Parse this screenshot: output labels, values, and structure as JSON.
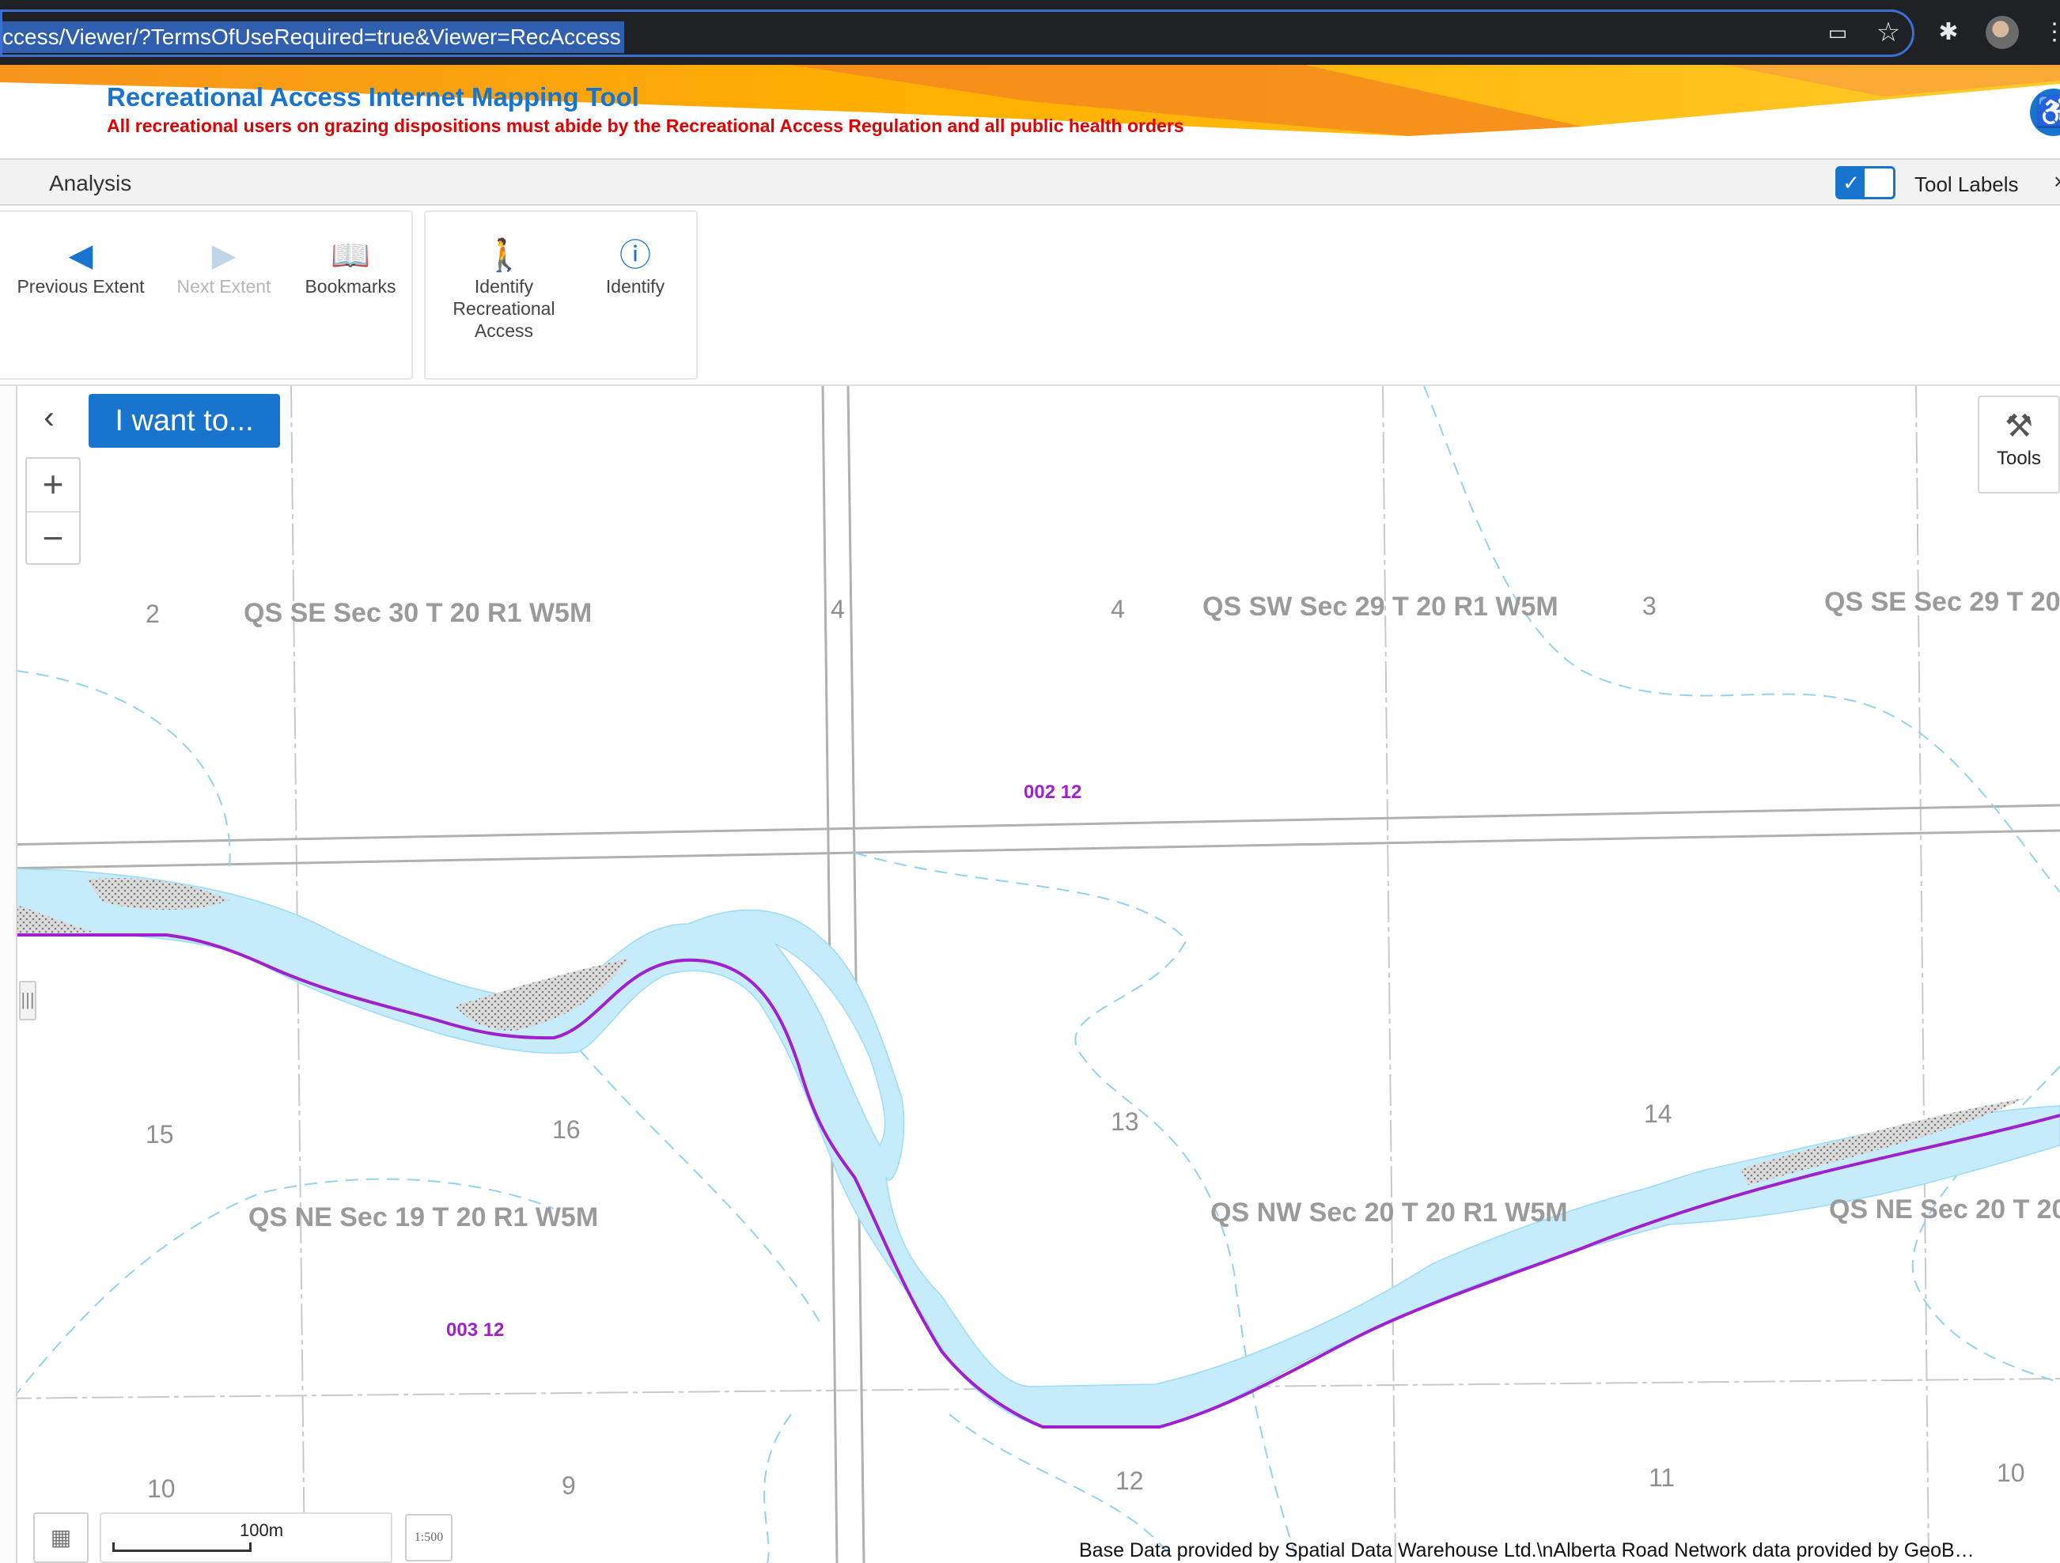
{
  "browser": {
    "url": "ccess/Viewer/?TermsOfUseRequired=true&Viewer=RecAccess",
    "icons": [
      "cast-icon",
      "star-icon",
      "extensions-icon",
      "avatar",
      "menu-icon"
    ]
  },
  "header": {
    "title": "Recreational Access Internet Mapping Tool",
    "subtitle": "All recreational users on grazing dispositions must abide by the Recreational Access Regulation and all public health orders"
  },
  "analysis_bar": {
    "tab": "Analysis",
    "tool_labels": "Tool Labels",
    "tool_labels_on": true
  },
  "toolbar": {
    "previous_extent": "Previous Extent",
    "next_extent": "Next Extent",
    "bookmarks": "Bookmarks",
    "identify_rec_1": "Identify",
    "identify_rec_2": "Recreational",
    "identify_rec_3": "Access",
    "identify": "Identify"
  },
  "map": {
    "i_want_to": "I want to...",
    "tools": "Tools",
    "scale_label": "100m",
    "scale_ratio": "1:500",
    "attribution": "Base Data provided by Spatial Data Warehouse Ltd.\\nAlberta Road Network data provided by GeoB…",
    "quarter_sections": [
      "QS SE Sec 30 T 20 R1 W5M",
      "QS SW Sec 29 T 20 R1 W5M",
      "QS SE Sec 29 T 20",
      "QS NE Sec 19 T 20 R1 W5M",
      "QS NW Sec 20 T 20 R1 W5M",
      "QS NE Sec 20 T 20"
    ],
    "section_numbers": [
      "2",
      "4",
      "4",
      "3",
      "15",
      "16",
      "13",
      "14",
      "10",
      "9",
      "12",
      "11",
      "10"
    ],
    "parcels": [
      "002 12",
      "003 12"
    ]
  },
  "colors": {
    "accent": "#1874cd",
    "warning": "#e00000",
    "river_fill": "#c6ebfb",
    "boundary": "#a020d0"
  }
}
